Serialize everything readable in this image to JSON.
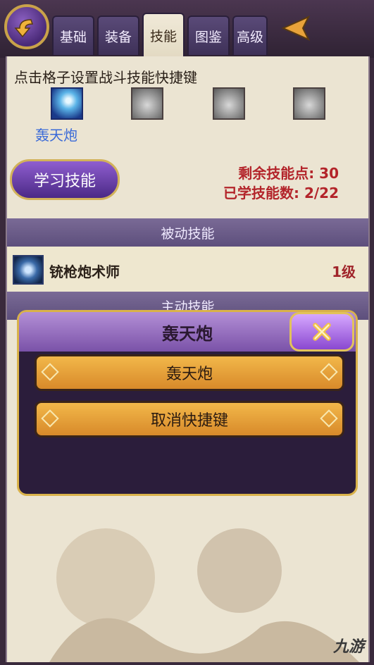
{
  "tabs": [
    {
      "label": "基础",
      "active": false
    },
    {
      "label": "装备",
      "active": false
    },
    {
      "label": "技能",
      "active": true
    },
    {
      "label": "图鉴",
      "active": false
    },
    {
      "label": "高级",
      "active": false
    }
  ],
  "hint": "点击格子设置战斗技能快捷键",
  "shortcut_slots": [
    {
      "label": "轰天炮",
      "filled": true
    },
    {
      "label": "",
      "filled": false
    },
    {
      "label": "",
      "filled": false
    },
    {
      "label": "",
      "filled": false
    }
  ],
  "learn_button": "学习技能",
  "stats": {
    "remaining_points": "剩余技能点: 30",
    "learned_count": "已学技能数: 2/22"
  },
  "passive_header": "被动技能",
  "passive_skill": {
    "name": "铳枪炮术师",
    "level": "1级"
  },
  "active_header": "主动技能",
  "modal": {
    "title": "轰天炮",
    "options": [
      "轰天炮",
      "取消快捷键"
    ]
  },
  "watermark": "九游",
  "colors": {
    "accent_red": "#b3242a",
    "tab_bg": "#5a4a78",
    "option_gold": "#e8a23a",
    "modal_bg": "#2b1d3b"
  }
}
